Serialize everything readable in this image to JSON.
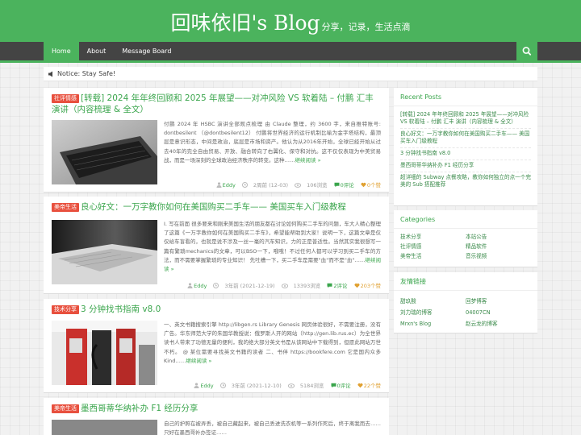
{
  "site": {
    "title": "回味依旧's Blog",
    "subtitle": "分享，记录，生活点滴"
  },
  "nav": {
    "items": [
      "Home",
      "About",
      "Message Board"
    ],
    "active": 0,
    "search_icon": "search-icon"
  },
  "notice": {
    "text": "Notice: Stay Safe!",
    "icon": "speaker-icon"
  },
  "posts": [
    {
      "category": "社评情感",
      "title": "[转载] 2024 年年终回顾和 2025 年展望——对冲风险 VS 软着陆 – 付鹏 汇丰 演讲（内容梳理 & 全文）",
      "excerpt": "付鹏 2024 年 HSBC 演讲全部观点梳理 由 Claude 整理，约 3600 字，来自推特账号: dontbesilent （@dontbesilent12） 付鹏将世界经济的运行机制比喻为金字塔结构，最顶层是意识形态，中间是政治，底层是市场和资产。他认为从2016年开始，全球已经开始从过去40年的完全自由贸易、开放、融合转向了右翼化、保守和对抗。这不仅仅表现为中美贸易战，而是一场深刻的全球政治经济秩序的转变。这种……",
      "more": "继续阅读 »",
      "author": "Eddy",
      "date": "2周前 (12-03)",
      "views": "106浏览",
      "comments": "0评论",
      "likes": "0个赞"
    },
    {
      "category": "美帝生活",
      "title": "良心好文：一万字教你如何在美国购买二手车—— 美国买车入门级教程",
      "excerpt": "I. 写在前面 很多要来和刚来美国生活的朋友都在讨论如何购买二手车的问题，车大人精心整理了这篇《一万字教你如何在美国购买二手车》，希望能帮助到大家！说明一下，这篇文章是仅仅给车盲看的，也就是说不涉及一丝一毫的汽车知识，力的正是普适性。当然其实我很想写一篇有繁琐mechanics的文章，可以BSO一下，哦哦！不过任何人都可以学习到买二手车的方法，而不需要掌握繁琐的专业知识！ 先吐槽一下，买二手车是需要\"血\"而不是\"血\"……",
      "more": "继续阅读 »",
      "author": "Eddy",
      "date": "3年前 (2021-12-19)",
      "views": "13393浏览",
      "comments": "2评论",
      "likes": "203个赞"
    },
    {
      "category": "技术分享",
      "title": "3 分钟找书指南 v8.0",
      "excerpt": "一、英文书籍搜索引擎 http://libgen.rs Library Genesis 网页体验很好，不需要注册，没有广告。华东师范大学的朱国华教授说：俄罗斯人开的网站（http://gen.lib.rus.ec）为全世界读书人带来了功德无量的便利，我的绝大部分英文书是从该网站中下载得到，但愿此网站万世不朽。 @ 某位需要寻找英文书籍的读者 二、书伴 https://bookfere.com 它是国内众多 Kind……",
      "more": "继续阅读 »",
      "author": "Eddy",
      "date": "3年前 (2021-12-10)",
      "views": "5184浏览",
      "comments": "0评论",
      "likes": "22个赞"
    },
    {
      "category": "美帝生活",
      "title": "墨西哥蒂华纳补办 F1 经历分享",
      "excerpt": "自己的护照在被弄丢，被自己藏起来，被自己丢进洗衣机等一系列作死后，终于离我而去……只好在墨西哥补办签证……",
      "more": "",
      "author": "",
      "date": "",
      "views": "",
      "comments": "",
      "likes": ""
    }
  ],
  "sidebar": {
    "recent": {
      "title": "Recent Posts",
      "items": [
        "[转载] 2024 年年终回顾和 2025 年展望——对冲风险 VS 软着陆 – 付鹏 汇丰 演讲（内容梳理 & 全文）",
        "良心好文：一万字教你如何在美国购买二手车—— 美国买车入门级教程",
        "3 分钟找书指南 v8.0",
        "墨西哥蒂华纳补办 F1 经历分享",
        "超详细的 Subway 点餐攻略，教你如何独立的点一个完美的 Sub 搭配推荐"
      ]
    },
    "categories": {
      "title": "Categories",
      "items": [
        "技术分享",
        "本站公告",
        "社评情感",
        "精品软件",
        "美帝生活",
        "音乐视频"
      ]
    },
    "links": {
      "title": "友情链接",
      "items": [
        "甜玖酸",
        "回梦博客",
        "刘力瑞的博客",
        "04007CN",
        "Mrxn's Blog",
        "赵云龙的博客"
      ]
    }
  },
  "colors": {
    "header": "#4bb35d",
    "navbar": "#444444",
    "link": "#3aa54c",
    "category_badge": "#e8503e"
  }
}
